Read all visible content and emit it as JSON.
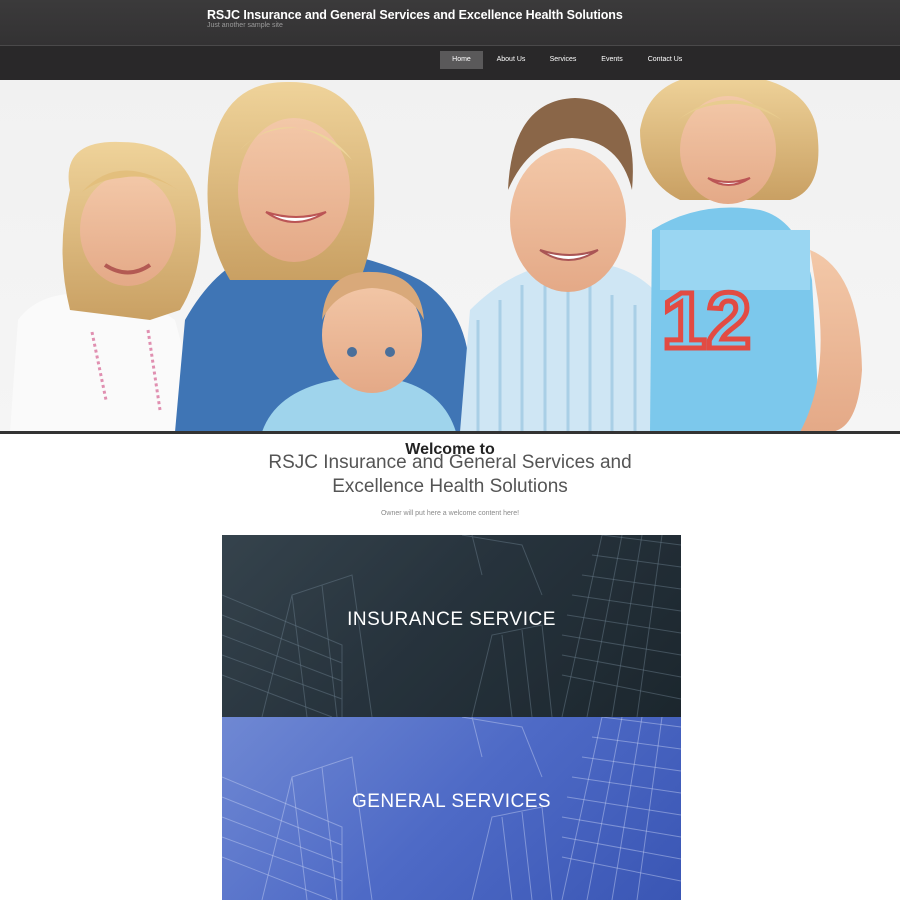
{
  "header": {
    "site_title": "RSJC Insurance and General Services and Excellence Health Solutions",
    "tagline": "Just another sample site"
  },
  "nav": {
    "items": [
      {
        "label": "Home"
      },
      {
        "label": "About Us"
      },
      {
        "label": "Services"
      },
      {
        "label": "Events"
      },
      {
        "label": "Contact Us"
      }
    ]
  },
  "welcome": {
    "overline": "Welcome to",
    "title_line1": "RSJC Insurance and General Services and",
    "title_line2": "Excellence Health Solutions",
    "content": "Owner will put here a welcome content here!"
  },
  "services": {
    "insurance_label": "INSURANCE SERVICE",
    "general_label": "GENERAL SERVICES"
  },
  "colors": {
    "header_bg": "#363536",
    "nav_bg": "#292829",
    "nav_active_bg": "#5a595a",
    "insurance_tile": "#2e3a44",
    "general_tile": "#5570c9"
  }
}
